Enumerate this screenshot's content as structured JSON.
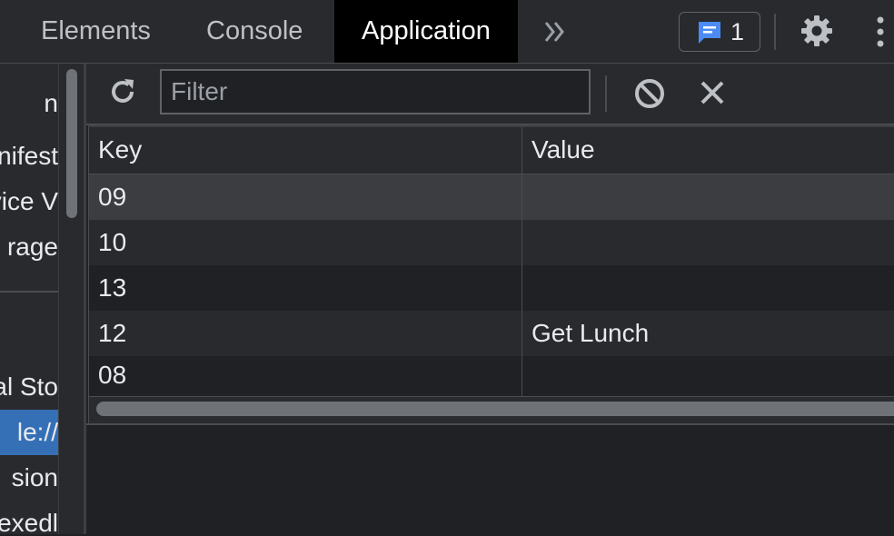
{
  "tabs": {
    "elements": "Elements",
    "console": "Console",
    "application": "Application"
  },
  "toolbar_top": {
    "issues_count": "1"
  },
  "sidebar": {
    "items": [
      "n",
      "nifest",
      "vice V",
      "rage",
      "al Sto",
      "le://",
      "sion",
      "exedl"
    ]
  },
  "storage_toolbar": {
    "filter_placeholder": "Filter",
    "filter_value": ""
  },
  "table": {
    "columns": [
      "Key",
      "Value"
    ],
    "rows": [
      {
        "key": "09",
        "value": ""
      },
      {
        "key": "10",
        "value": ""
      },
      {
        "key": "13",
        "value": ""
      },
      {
        "key": "12",
        "value": "Get Lunch"
      },
      {
        "key": "08",
        "value": ""
      }
    ]
  },
  "colors": {
    "background": "#202124",
    "panel": "#292a2d",
    "selected_sidebar": "#356fb6",
    "issues_icon": "#4c8bf5"
  }
}
